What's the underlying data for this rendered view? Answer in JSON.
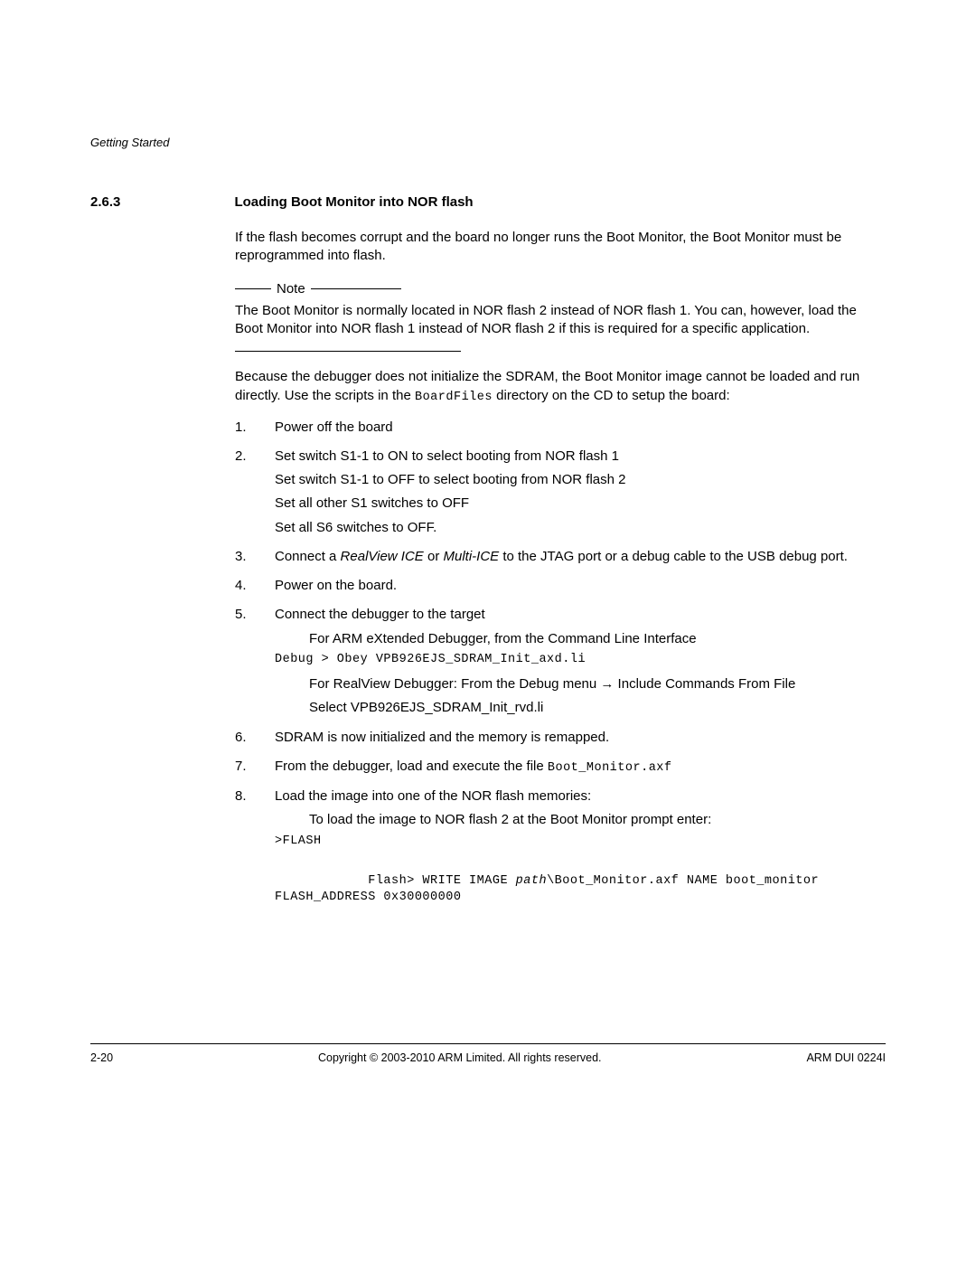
{
  "header": {
    "running": "Getting Started"
  },
  "section": {
    "number": "2.6.3",
    "title": "Loading Boot Monitor into NOR flash"
  },
  "intro": "If the flash becomes corrupt and the board no longer runs the Boot Monitor, the Boot Monitor must be reprogrammed into flash.",
  "note": {
    "label": "Note",
    "text": "The Boot Monitor is normally located in NOR flash 2 instead of NOR flash 1. You can, however, load the Boot Monitor into NOR flash 1 instead of NOR flash 2 if this is required for a specific application."
  },
  "because": {
    "a": "Because the debugger does not initialize the SDRAM, the Boot Monitor image cannot be loaded and run directly. Use the scripts in the ",
    "code": "BoardFiles",
    "b": " directory on the CD to setup the board:"
  },
  "steps": {
    "s1": {
      "n": "1.",
      "t": "Power off the board"
    },
    "s2": {
      "n": "2.",
      "l1": "Set switch S1-1 to ON to select booting from NOR flash 1",
      "l2": "Set switch S1-1 to OFF to select booting from NOR flash 2",
      "l3": "Set all other S1 switches to OFF",
      "l4": "Set all S6 switches to OFF."
    },
    "s3": {
      "n": "3.",
      "a": "Connect a ",
      "i1": "RealView ICE",
      "b": " or ",
      "i2": "Multi-ICE",
      "c": " to the JTAG port or a debug cable to the USB debug port."
    },
    "s4": {
      "n": "4.",
      "t": "Power on the board."
    },
    "s5": {
      "n": "5.",
      "t": "Connect the debugger to the target",
      "sub1": "For ARM eXtended Debugger, from the Command Line Interface",
      "code1": "Debug > Obey VPB926EJS_SDRAM_Init_axd.li",
      "sub2a": "For RealView Debugger: From the Debug menu ",
      "arrow": "→",
      "sub2b": " Include Commands From File",
      "sub3": "Select VPB926EJS_SDRAM_Init_rvd.li"
    },
    "s6": {
      "n": "6.",
      "t": "SDRAM is now initialized and the memory is remapped."
    },
    "s7": {
      "n": "7.",
      "a": "From the debugger, load and execute the file ",
      "code": "Boot_Monitor.axf"
    },
    "s8": {
      "n": "8.",
      "t": "Load the image into one of the NOR flash memories:",
      "sub1a": "To load the image to NOR flash 2 at the Boot Monitor prompt enter:",
      "code1": ">FLASH",
      "code2a": "Flash> WRITE IMAGE ",
      "code2path": "path",
      "code2b": "\\Boot_Monitor.axf NAME boot_monitor FLASH_ADDRESS 0x30000000"
    }
  },
  "footer": {
    "left": "2-20",
    "center": "Copyright © 2003-2010 ARM Limited. All rights reserved.",
    "right": "ARM DUI 0224I"
  }
}
